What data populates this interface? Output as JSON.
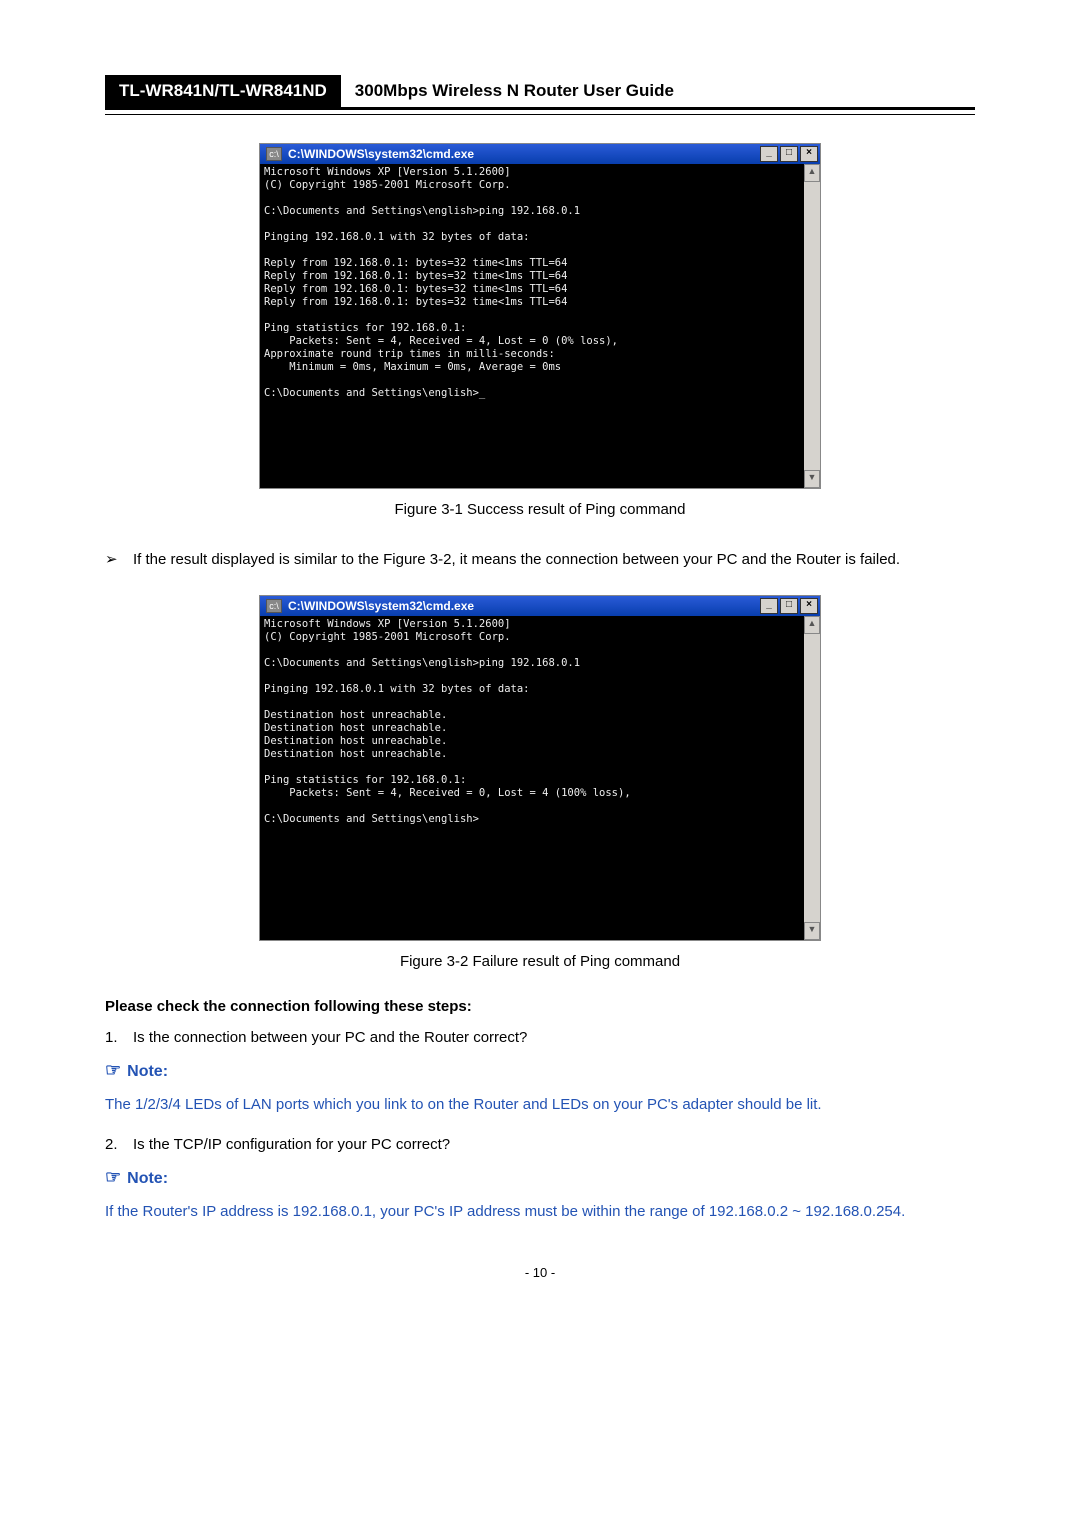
{
  "header": {
    "model": "TL-WR841N/TL-WR841ND",
    "title": "300Mbps Wireless N Router User Guide"
  },
  "cmd1": {
    "title": "C:\\WINDOWS\\system32\\cmd.exe",
    "body": "Microsoft Windows XP [Version 5.1.2600]\n(C) Copyright 1985-2001 Microsoft Corp.\n\nC:\\Documents and Settings\\english>ping 192.168.0.1\n\nPinging 192.168.0.1 with 32 bytes of data:\n\nReply from 192.168.0.1: bytes=32 time<1ms TTL=64\nReply from 192.168.0.1: bytes=32 time<1ms TTL=64\nReply from 192.168.0.1: bytes=32 time<1ms TTL=64\nReply from 192.168.0.1: bytes=32 time<1ms TTL=64\n\nPing statistics for 192.168.0.1:\n    Packets: Sent = 4, Received = 4, Lost = 0 (0% loss),\nApproximate round trip times in milli-seconds:\n    Minimum = 0ms, Maximum = 0ms, Average = 0ms\n\nC:\\Documents and Settings\\english>_"
  },
  "caption1": "Figure 3-1    Success result of Ping command",
  "para1": "If the result displayed is similar to the Figure 3-2, it means the connection between your PC and the Router is failed.",
  "cmd2": {
    "title": "C:\\WINDOWS\\system32\\cmd.exe",
    "body": "Microsoft Windows XP [Version 5.1.2600]\n(C) Copyright 1985-2001 Microsoft Corp.\n\nC:\\Documents and Settings\\english>ping 192.168.0.1\n\nPinging 192.168.0.1 with 32 bytes of data:\n\nDestination host unreachable.\nDestination host unreachable.\nDestination host unreachable.\nDestination host unreachable.\n\nPing statistics for 192.168.0.1:\n    Packets: Sent = 4, Received = 0, Lost = 4 (100% loss),\n\nC:\\Documents and Settings\\english>"
  },
  "caption2": "Figure 3-2    Failure result of Ping command",
  "heading": "Please check the connection following these steps:",
  "step1_num": "1.",
  "step1": "Is the connection between your PC and the Router correct?",
  "note_label": "Note:",
  "note1": "The 1/2/3/4 LEDs of LAN ports which you link to on the Router and LEDs on your PC's adapter should be lit.",
  "step2_num": "2.",
  "step2": "Is the TCP/IP configuration for your PC correct?",
  "note2": "If the Router's IP address is 192.168.0.1, your PC's IP address must be within the range of 192.168.0.2 ~ 192.168.0.254.",
  "pagenum": "- 10 -",
  "arrow_glyph": "➢",
  "hand_glyph": "☞",
  "win_buttons": {
    "min": "_",
    "max": "□",
    "close": "×"
  },
  "scroll": {
    "up": "▲",
    "down": "▼"
  },
  "cmd_icon_glyph": "c:\\"
}
